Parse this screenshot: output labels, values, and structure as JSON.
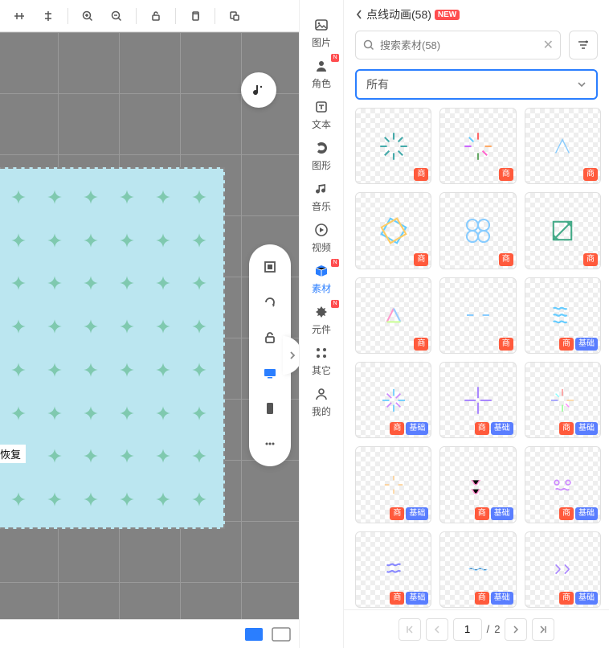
{
  "toolbar": {
    "tools": [
      "align-h",
      "align-v",
      "",
      "zoom-in",
      "zoom-out",
      "",
      "unlock",
      "",
      "copy",
      "",
      "paste"
    ]
  },
  "canvas": {
    "recover_label": "恢复"
  },
  "categories": [
    {
      "key": "image",
      "label": "图片",
      "badge": false
    },
    {
      "key": "character",
      "label": "角色",
      "badge": true
    },
    {
      "key": "text",
      "label": "文本",
      "badge": false
    },
    {
      "key": "shape",
      "label": "图形",
      "badge": false
    },
    {
      "key": "music",
      "label": "音乐",
      "badge": false
    },
    {
      "key": "video",
      "label": "视频",
      "badge": false
    },
    {
      "key": "material",
      "label": "素材",
      "badge": true,
      "active": true
    },
    {
      "key": "component",
      "label": "元件",
      "badge": true
    },
    {
      "key": "other",
      "label": "其它",
      "badge": false
    },
    {
      "key": "mine",
      "label": "我的",
      "badge": false
    }
  ],
  "panel": {
    "title": "点线动画(58)",
    "new_badge": "NEW",
    "search_placeholder": "搜索素材(58)",
    "filter_selected": "所有",
    "badge_shang": "商",
    "badge_jichu": "基础"
  },
  "assets": [
    {
      "shang": true,
      "jichu": false
    },
    {
      "shang": true,
      "jichu": false
    },
    {
      "shang": true,
      "jichu": false
    },
    {
      "shang": true,
      "jichu": false
    },
    {
      "shang": true,
      "jichu": false
    },
    {
      "shang": true,
      "jichu": false
    },
    {
      "shang": true,
      "jichu": false
    },
    {
      "shang": true,
      "jichu": false
    },
    {
      "shang": true,
      "jichu": true
    },
    {
      "shang": true,
      "jichu": true
    },
    {
      "shang": true,
      "jichu": true
    },
    {
      "shang": true,
      "jichu": true
    },
    {
      "shang": true,
      "jichu": true
    },
    {
      "shang": true,
      "jichu": true
    },
    {
      "shang": true,
      "jichu": true
    },
    {
      "shang": true,
      "jichu": true
    },
    {
      "shang": true,
      "jichu": true
    },
    {
      "shang": true,
      "jichu": true
    }
  ],
  "pagination": {
    "current": "1",
    "sep": "/",
    "total": "2"
  }
}
